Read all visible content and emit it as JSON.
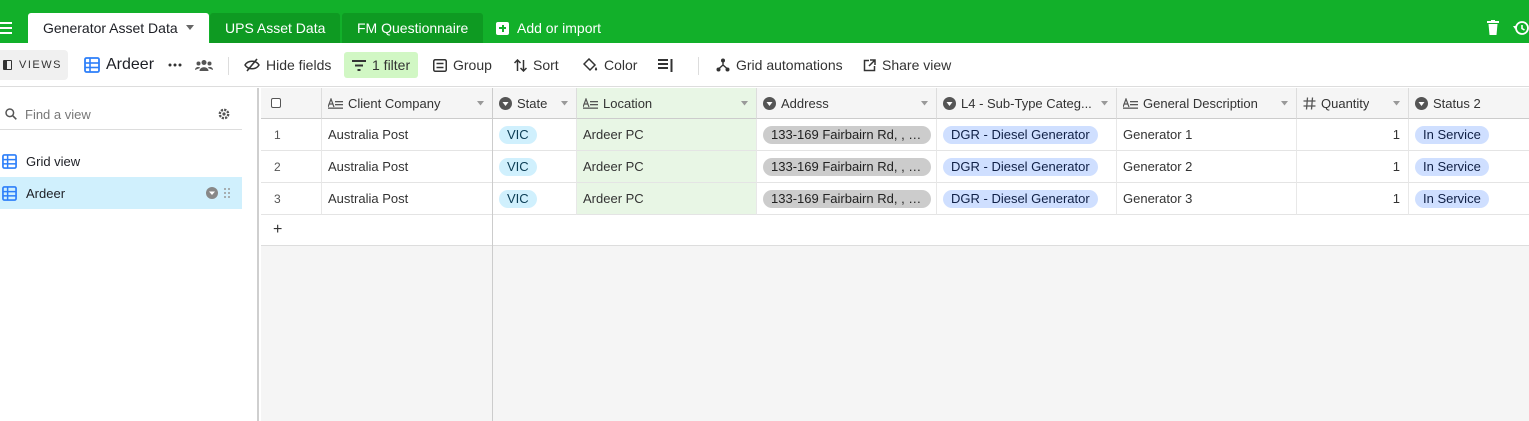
{
  "tabs": [
    {
      "label": "Generator Asset Data",
      "active": true
    },
    {
      "label": "UPS Asset Data",
      "active": false
    },
    {
      "label": "FM Questionnaire",
      "active": false
    }
  ],
  "add_tab_label": "Add or import",
  "toolbar": {
    "views_label": "VIEWS",
    "view_name": "Ardeer",
    "hide_fields": "Hide fields",
    "filter": "1 filter",
    "group": "Group",
    "sort": "Sort",
    "color": "Color",
    "grid_automations": "Grid automations",
    "share_view": "Share view"
  },
  "sidebar": {
    "search_placeholder": "Find a view",
    "views": [
      {
        "label": "Grid view",
        "selected": false
      },
      {
        "label": "Ardeer",
        "selected": true
      }
    ]
  },
  "grid": {
    "columns": [
      {
        "label": "Client Company",
        "icon": "long-text-icon"
      },
      {
        "label": "State",
        "icon": "single-select-icon"
      },
      {
        "label": "Location",
        "icon": "long-text-icon"
      },
      {
        "label": "Address",
        "icon": "single-select-icon"
      },
      {
        "label": "L4 - Sub-Type Categ...",
        "icon": "single-select-icon"
      },
      {
        "label": "General Description",
        "icon": "long-text-icon"
      },
      {
        "label": "Quantity",
        "icon": "number-icon"
      },
      {
        "label": "Status 2",
        "icon": "single-select-icon"
      }
    ],
    "rows": [
      {
        "num": "1",
        "client": "Australia Post",
        "state": "VIC",
        "location": "Ardeer PC",
        "address": "133-169 Fairbairn Rd, , , ,...",
        "subtype": "DGR - Diesel Generator",
        "description": "Generator 1",
        "quantity": "1",
        "status": "In Service"
      },
      {
        "num": "2",
        "client": "Australia Post",
        "state": "VIC",
        "location": "Ardeer PC",
        "address": "133-169 Fairbairn Rd, , , ,...",
        "subtype": "DGR - Diesel Generator",
        "description": "Generator 2",
        "quantity": "1",
        "status": "In Service"
      },
      {
        "num": "3",
        "client": "Australia Post",
        "state": "VIC",
        "location": "Ardeer PC",
        "address": "133-169 Fairbairn Rd, , , ,...",
        "subtype": "DGR - Diesel Generator",
        "description": "Generator 3",
        "quantity": "1",
        "status": "In Service"
      }
    ],
    "add_row_label": "+"
  },
  "colors": {
    "brand": "#12b02a",
    "filter_bg": "#d1f7c4",
    "selected_view": "#d0f0fd",
    "location_col": "#e8f6e5"
  }
}
